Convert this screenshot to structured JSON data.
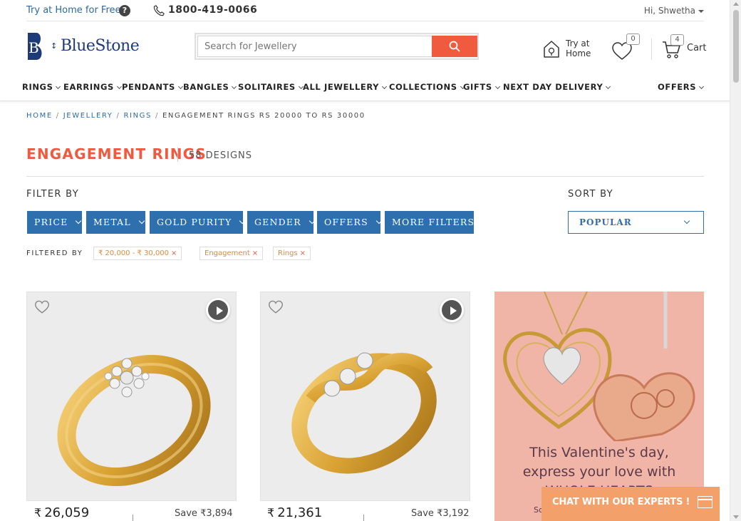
{
  "topbar": {
    "try_home": "Try at Home for Free",
    "help": "?",
    "phone": "1800-419-0066",
    "user": "Hi, Shwetha"
  },
  "header": {
    "brand": "BlueStone",
    "logo_letter": "B",
    "search_placeholder": "Search for Jewellery",
    "try_home_line1": "Try at",
    "try_home_line2": "Home",
    "wishlist_count": "0",
    "cart_count": "4",
    "cart_label": "Cart"
  },
  "nav": {
    "items": [
      "RINGS",
      "EARRINGS",
      "PENDANTS",
      "BANGLES",
      "SOLITAIRES",
      "ALL JEWELLERY",
      "COLLECTIONS",
      "GIFTS",
      "NEXT DAY DELIVERY",
      "OFFERS"
    ]
  },
  "breadcrumb": {
    "home": "HOME",
    "jewellery": "JEWELLERY",
    "rings": "RINGS",
    "current": "ENGAGEMENT RINGS RS 20000 TO RS 30000",
    "separator": "/"
  },
  "listing": {
    "title": "ENGAGEMENT RINGS",
    "count": "58 DESIGNS",
    "filter_by": "FILTER BY",
    "sort_by": "SORT BY",
    "filters": [
      "PRICE",
      "METAL",
      "GOLD PURITY",
      "GENDER",
      "OFFERS",
      "MORE FILTERS"
    ],
    "sort_value": "POPULAR",
    "filtered_by": "FILTERED BY",
    "chips": [
      "₹ 20,000 - ₹ 30,000",
      "Engagement",
      "Rings"
    ],
    "chip_remove": "×"
  },
  "products": [
    {
      "price": "26,059",
      "save_label": "Save",
      "save": "3,894"
    },
    {
      "price": "21,361",
      "save_label": "Save",
      "save": "3,192"
    }
  ],
  "currency": "₹",
  "promo": {
    "line1": "This Valentine's day,",
    "line2": "express your love with",
    "line3": "WHOLE HEARTS",
    "footer": "Sculpt"
  },
  "chat": {
    "label": "CHAT WITH OUR EXPERTS !"
  },
  "colors": {
    "accent": "#f05a3f",
    "primary_blue": "#2e6fad",
    "brand_navy": "#1e3a78"
  }
}
